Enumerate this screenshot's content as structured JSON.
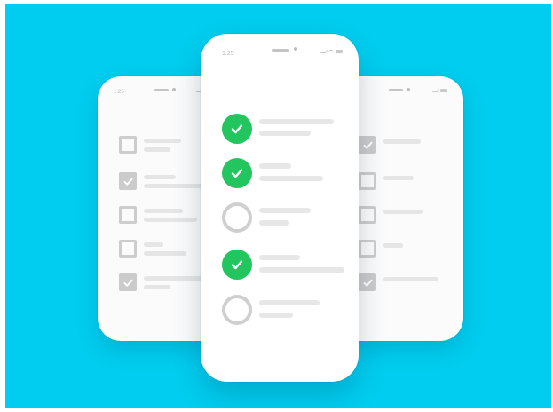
{
  "colors": {
    "background": "#00cdef",
    "done": "#22c55e",
    "muted": "#cfcfcf"
  },
  "phones": {
    "left": {
      "time": "1:25",
      "items": [
        {
          "state": "unchecked"
        },
        {
          "state": "checked"
        },
        {
          "state": "unchecked"
        },
        {
          "state": "unchecked"
        },
        {
          "state": "checked"
        }
      ]
    },
    "center": {
      "time": "1:25",
      "items": [
        {
          "state": "done"
        },
        {
          "state": "done"
        },
        {
          "state": "pending"
        },
        {
          "state": "done"
        },
        {
          "state": "pending"
        }
      ]
    },
    "right": {
      "items": [
        {
          "state": "checked"
        },
        {
          "state": "unchecked"
        },
        {
          "state": "unchecked"
        },
        {
          "state": "unchecked"
        },
        {
          "state": "checked"
        }
      ]
    }
  },
  "icons": {
    "check": "check-icon",
    "signal": "signal-icon",
    "wifi": "wifi-icon",
    "battery": "battery-icon"
  }
}
